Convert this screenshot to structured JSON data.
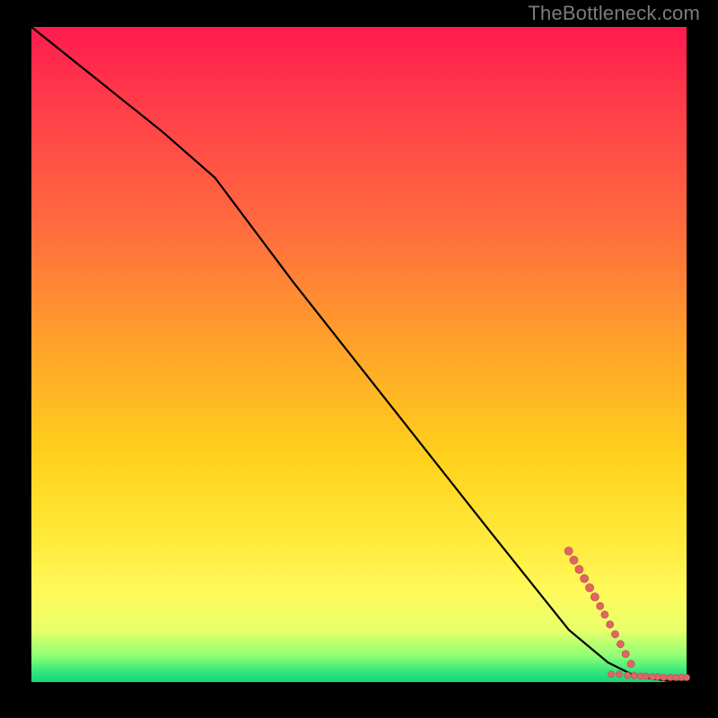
{
  "watermark": "TheBottleneck.com",
  "colors": {
    "background": "#000000",
    "watermark": "#7c7c7c",
    "curve": "#000000",
    "point_fill": "#e06666",
    "point_stroke": "#c25454"
  },
  "chart_data": {
    "type": "line",
    "title": "",
    "xlabel": "",
    "ylabel": "",
    "xlim": [
      0,
      100
    ],
    "ylim": [
      0,
      100
    ],
    "grid": false,
    "legend": false,
    "gradient_stops": [
      {
        "pos": 0,
        "color": "#ff1a4f"
      },
      {
        "pos": 30,
        "color": "#ff6a3e"
      },
      {
        "pos": 66,
        "color": "#ffd21c"
      },
      {
        "pos": 92,
        "color": "#e9ff6a"
      },
      {
        "pos": 100,
        "color": "#17d477"
      }
    ],
    "series": [
      {
        "name": "bottleneck-curve",
        "x": [
          0,
          10,
          20,
          28,
          40,
          55,
          70,
          82,
          88,
          92,
          95,
          97,
          98.5,
          100
        ],
        "y": [
          100,
          92,
          84,
          77,
          61,
          42,
          23,
          8,
          3,
          1,
          0.5,
          0.2,
          0.1,
          0.1
        ]
      }
    ],
    "points": [
      {
        "x": 82.0,
        "y": 20.0,
        "r": 4.5
      },
      {
        "x": 82.8,
        "y": 18.6,
        "r": 4.5
      },
      {
        "x": 83.6,
        "y": 17.2,
        "r": 4.5
      },
      {
        "x": 84.4,
        "y": 15.8,
        "r": 4.5
      },
      {
        "x": 85.2,
        "y": 14.4,
        "r": 4.5
      },
      {
        "x": 86.0,
        "y": 13.0,
        "r": 4.5
      },
      {
        "x": 86.8,
        "y": 11.6,
        "r": 4.0
      },
      {
        "x": 87.5,
        "y": 10.3,
        "r": 4.0
      },
      {
        "x": 88.3,
        "y": 8.8,
        "r": 4.0
      },
      {
        "x": 89.1,
        "y": 7.3,
        "r": 4.0
      },
      {
        "x": 89.9,
        "y": 5.8,
        "r": 4.0
      },
      {
        "x": 90.7,
        "y": 4.3,
        "r": 4.0
      },
      {
        "x": 91.5,
        "y": 2.8,
        "r": 4.0
      },
      {
        "x": 88.5,
        "y": 1.2,
        "r": 3.5
      },
      {
        "x": 89.7,
        "y": 1.2,
        "r": 3.5
      },
      {
        "x": 91.0,
        "y": 1.0,
        "r": 3.5
      },
      {
        "x": 92.0,
        "y": 1.0,
        "r": 3.5
      },
      {
        "x": 93.0,
        "y": 0.9,
        "r": 3.5
      },
      {
        "x": 93.8,
        "y": 0.9,
        "r": 3.5
      },
      {
        "x": 94.8,
        "y": 0.8,
        "r": 3.5
      },
      {
        "x": 95.6,
        "y": 0.8,
        "r": 3.5
      },
      {
        "x": 96.5,
        "y": 0.7,
        "r": 3.5
      },
      {
        "x": 97.5,
        "y": 0.7,
        "r": 3.5
      },
      {
        "x": 98.4,
        "y": 0.7,
        "r": 3.5
      },
      {
        "x": 99.2,
        "y": 0.7,
        "r": 3.5
      },
      {
        "x": 100.0,
        "y": 0.7,
        "r": 3.5
      }
    ]
  }
}
